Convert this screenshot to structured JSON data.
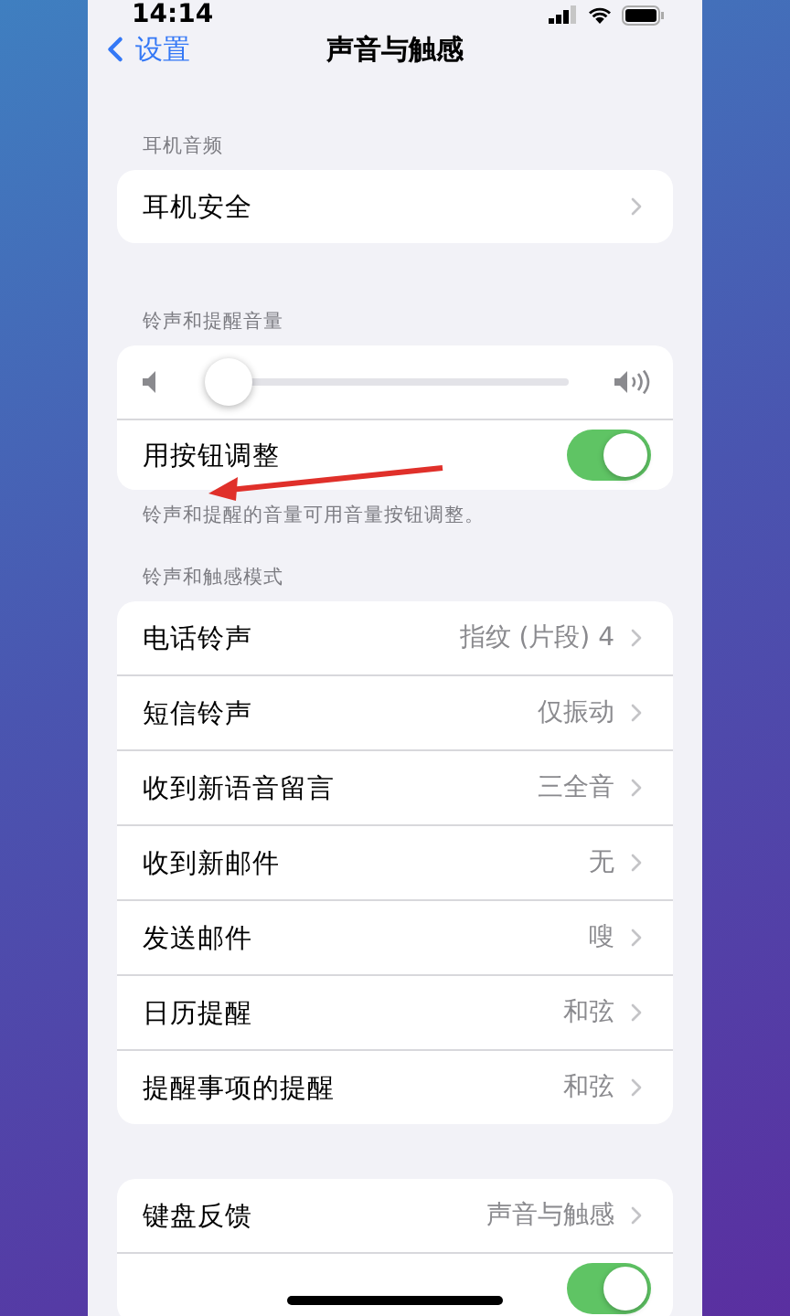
{
  "status_bar": {
    "time": "14:14"
  },
  "nav": {
    "back": "设置",
    "title": "声音与触感"
  },
  "sections": [
    {
      "header": "耳机音频",
      "rows": [
        {
          "kind": "link",
          "label": "耳机安全"
        }
      ]
    },
    {
      "header": "铃声和提醒音量",
      "rows": [
        {
          "kind": "slider",
          "level": 0.06
        },
        {
          "kind": "toggle",
          "label": "用按钮调整",
          "on": true
        }
      ],
      "footer": "铃声和提醒的音量可用音量按钮调整。"
    },
    {
      "header": "铃声和触感模式",
      "rows": [
        {
          "kind": "link",
          "label": "电话铃声",
          "value": "指纹 (片段) 4"
        },
        {
          "kind": "link",
          "label": "短信铃声",
          "value": "仅振动"
        },
        {
          "kind": "link",
          "label": "收到新语音留言",
          "value": "三全音"
        },
        {
          "kind": "link",
          "label": "收到新邮件",
          "value": "无"
        },
        {
          "kind": "link",
          "label": "发送邮件",
          "value": "嗖"
        },
        {
          "kind": "link",
          "label": "日历提醒",
          "value": "和弦"
        },
        {
          "kind": "link",
          "label": "提醒事项的提醒",
          "value": "和弦"
        }
      ]
    },
    {
      "rows": [
        {
          "kind": "link",
          "label": "键盘反馈",
          "value": "声音与触感"
        },
        {
          "kind": "toggle",
          "on": true
        }
      ]
    }
  ]
}
